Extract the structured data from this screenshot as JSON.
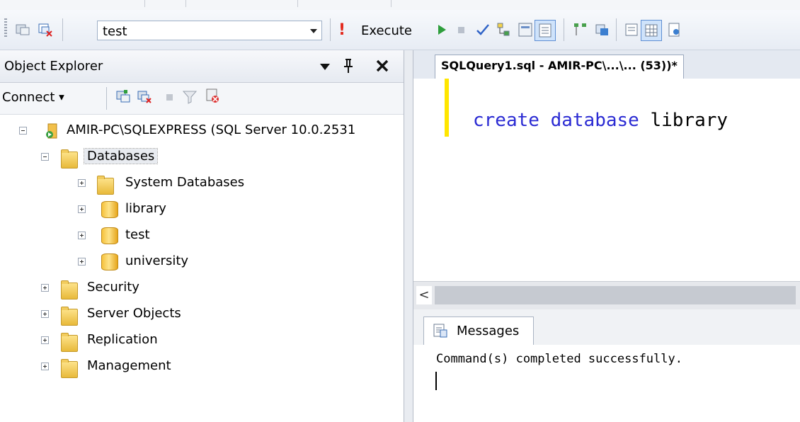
{
  "toolbar": {
    "database": "test",
    "execute_label": "Execute"
  },
  "object_explorer": {
    "title": "Object Explorer",
    "connect_label": "Connect",
    "tree": [
      {
        "label": "AMIR-PC\\SQLEXPRESS (SQL Server 10.0.2531",
        "icon": "server-icon",
        "expanded": true
      },
      {
        "label": "Databases",
        "icon": "folder-icon",
        "expanded": true
      },
      {
        "label": "System Databases",
        "icon": "folder-icon",
        "expanded": false
      },
      {
        "label": "library",
        "icon": "database-icon",
        "expanded": false
      },
      {
        "label": "test",
        "icon": "database-icon",
        "expanded": false
      },
      {
        "label": "university",
        "icon": "database-icon",
        "expanded": false
      },
      {
        "label": "Security",
        "icon": "folder-icon",
        "expanded": false
      },
      {
        "label": "Server Objects",
        "icon": "folder-icon",
        "expanded": false
      },
      {
        "label": "Replication",
        "icon": "folder-icon",
        "expanded": false
      },
      {
        "label": "Management",
        "icon": "folder-icon",
        "expanded": false
      }
    ]
  },
  "editor": {
    "tab_title": "SQLQuery1.sql - AMIR-PC\\...\\... (53))*",
    "code_keyword1": "create",
    "code_keyword2": "database",
    "code_identifier": "library"
  },
  "results": {
    "tab_label": "Messages",
    "message": "Command(s) completed successfully."
  },
  "colors": {
    "keyword": "#2b2bd3",
    "execute_bang": "#e3281c",
    "change_marker": "#ffe600"
  }
}
